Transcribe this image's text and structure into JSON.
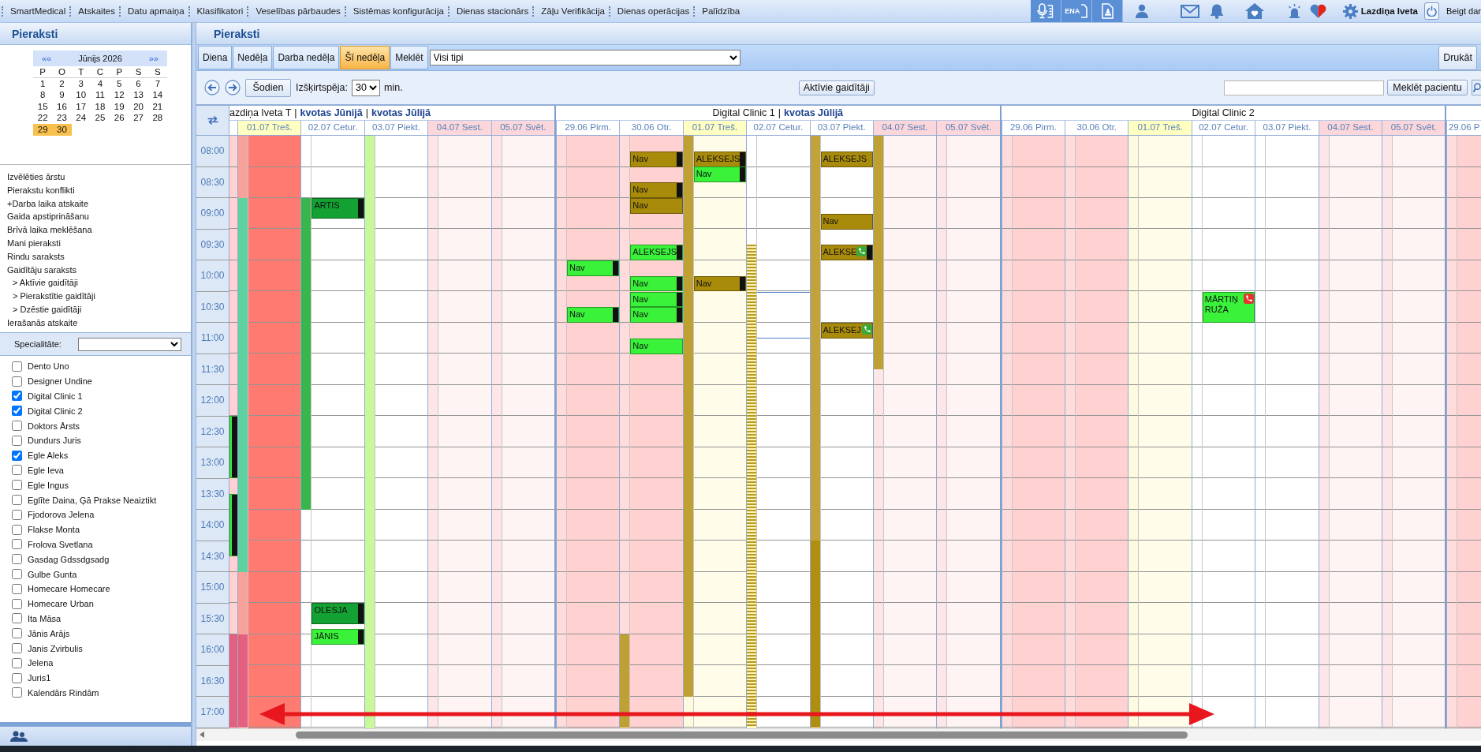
{
  "menu_bar": {
    "items": [
      "SmartMedical",
      "Atskaites",
      "Datu apmaiņa",
      "Klasifikatori",
      "Veselības pārbaudes",
      "Sistēmas konfigurācija",
      "Dienas stacionārs",
      "Zāļu Verifikācija",
      "Dienas operācijas",
      "Palīdzība"
    ],
    "quick_buttons": [
      {
        "kind": "dictation"
      },
      {
        "kind": "ena",
        "label": "ENA"
      },
      {
        "kind": "stamp"
      }
    ],
    "user": "Lazdiņa Iveta",
    "logout": "Beigt dar"
  },
  "left_panel": {
    "title": "Pieraksti",
    "calendar": {
      "prev": "««",
      "month": "Jūnijs 2026",
      "next": "»»",
      "weekdays": [
        "P",
        "O",
        "T",
        "C",
        "P",
        "S",
        "S"
      ],
      "weeks": [
        [
          {
            "day": "1",
            "selected": false
          },
          {
            "day": "2",
            "selected": false
          },
          {
            "day": "3",
            "selected": false
          },
          {
            "day": "4",
            "selected": false
          },
          {
            "day": "5",
            "selected": false
          },
          {
            "day": "6",
            "selected": false
          },
          {
            "day": "7",
            "selected": false
          }
        ],
        [
          {
            "day": "8",
            "selected": false
          },
          {
            "day": "9",
            "selected": false
          },
          {
            "day": "10",
            "selected": false
          },
          {
            "day": "11",
            "selected": false
          },
          {
            "day": "12",
            "selected": false
          },
          {
            "day": "13",
            "selected": false
          },
          {
            "day": "14",
            "selected": false
          }
        ],
        [
          {
            "day": "15",
            "selected": false
          },
          {
            "day": "16",
            "selected": false
          },
          {
            "day": "17",
            "selected": false
          },
          {
            "day": "18",
            "selected": false
          },
          {
            "day": "19",
            "selected": false
          },
          {
            "day": "20",
            "selected": false
          },
          {
            "day": "21",
            "selected": false
          }
        ],
        [
          {
            "day": "22",
            "selected": false
          },
          {
            "day": "23",
            "selected": false
          },
          {
            "day": "24",
            "selected": false
          },
          {
            "day": "25",
            "selected": false
          },
          {
            "day": "26",
            "selected": false
          },
          {
            "day": "27",
            "selected": false
          },
          {
            "day": "28",
            "selected": false
          }
        ],
        [
          {
            "day": "29",
            "selected": true
          },
          {
            "day": "30",
            "selected": true
          }
        ]
      ]
    },
    "links": [
      {
        "label": "Izvēlēties ārstu"
      },
      {
        "label": "Pierakstu konflikti"
      },
      {
        "label": "+Darba laika atskaite"
      },
      {
        "label": "Gaida apstiprināšanu"
      },
      {
        "label": "Brīvā laika meklēšana"
      },
      {
        "label": "Mani pieraksti"
      },
      {
        "label": "Rindu saraksts"
      },
      {
        "label": "Gaidītāju saraksts",
        "children": [
          {
            "label": "> Aktīvie gaidītāji"
          },
          {
            "label": "> Pierakstītie gaidītāji"
          },
          {
            "label": "> Dzēstie gaidītāji"
          }
        ]
      },
      {
        "label": "Ierašanās atskaite"
      }
    ],
    "specialty": {
      "label": "Specialitāte:"
    },
    "doctors": [
      {
        "name": "Dento Uno",
        "checked": false
      },
      {
        "name": "Designer Undine",
        "checked": false
      },
      {
        "name": "Digital Clinic 1",
        "checked": true
      },
      {
        "name": "Digital Clinic 2",
        "checked": true
      },
      {
        "name": "Doktors Ārsts",
        "checked": false
      },
      {
        "name": "Dundurs Juris",
        "checked": false
      },
      {
        "name": "Egle Aleks",
        "checked": true
      },
      {
        "name": "Egle Ieva",
        "checked": false
      },
      {
        "name": "Egle Ingus",
        "checked": false
      },
      {
        "name": "Eglīte Daina, Ģā Prakse Neaiztikt",
        "checked": false
      },
      {
        "name": "Fjodorova Jelena",
        "checked": false
      },
      {
        "name": "Flakse Monta",
        "checked": false
      },
      {
        "name": "Frolova Svetlana",
        "checked": false
      },
      {
        "name": "Gasdag Gdssdgsadg",
        "checked": false
      },
      {
        "name": "Gulbe Gunta",
        "checked": false
      },
      {
        "name": "Homecare Homecare",
        "checked": false
      },
      {
        "name": "Homecare Urban",
        "checked": false
      },
      {
        "name": "Ita Māsa",
        "checked": false
      },
      {
        "name": "Jānis Arājs",
        "checked": false
      },
      {
        "name": "Janis Zvirbulis",
        "checked": false
      },
      {
        "name": "Jelena",
        "checked": false
      },
      {
        "name": "Juris1",
        "checked": false
      },
      {
        "name": "Kalendārs Rindām",
        "checked": false
      }
    ]
  },
  "main": {
    "title": "Pieraksti",
    "tabs": [
      {
        "label": "Diena",
        "selected": false
      },
      {
        "label": "Nedēļa",
        "selected": false
      },
      {
        "label": "Darba nedēļa",
        "selected": false
      },
      {
        "label": "Šī nedēļa",
        "selected": true
      },
      {
        "label": "Meklēt",
        "selected": false
      }
    ],
    "type_filter": "Visi tipi",
    "print": "Drukāt",
    "toolbar": {
      "today": "Šodien",
      "resolution_label": "Izšķirtspēja:",
      "resolution": "30",
      "unit": "min.",
      "waitlist": "Aktīvie gaidītāji",
      "search_button": "Meklēt pacientu"
    },
    "schedule": {
      "times": [
        "08:00",
        "08:30",
        "09:00",
        "09:30",
        "10:00",
        "10:30",
        "11:00",
        "11:30",
        "12:00",
        "12:30",
        "13:00",
        "13:30",
        "14:00",
        "14:30",
        "15:00",
        "15:30",
        "16:00",
        "16:30",
        "17:00"
      ],
      "groups": [
        {
          "title": "azdiņa Iveta T",
          "links": [
            {
              "separator": "|",
              "label": "kvotas Jūnijā"
            },
            {
              "separator": "|",
              "label": "kvotas Jūlijā"
            }
          ],
          "days": [
            {
              "kind": "past",
              "absent": false,
              "items": [
                {
                  "kind": "appointment",
                  "color": "#39f239",
                  "marker": true
                },
                {
                  "kind": "appointment",
                  "color": "#39f239",
                  "marker": true
                },
                {
                  "kind": "fill",
                  "color": "#e4607e"
                }
              ]
            },
            {
              "label": "01.07 Treš.",
              "kind": "today",
              "absent": true,
              "stripe": [
                {
                  "kind": "solid",
                  "color": "#f6a19c"
                },
                {
                  "kind": "solid",
                  "color": "#5fd0a0"
                },
                {
                  "kind": "solid",
                  "color": "#f6a19c"
                },
                {
                  "kind": "solid",
                  "color": "#e4607e"
                }
              ]
            },
            {
              "label": "02.07 Cetur.",
              "kind": "workday",
              "absent": false,
              "stripe": [
                {
                  "kind": "solid",
                  "color": "#38b54b"
                }
              ],
              "items": [
                {
                  "kind": "appointment",
                  "text": "ARTIS",
                  "color": "#13a133",
                  "marker": true
                },
                {
                  "kind": "appointment",
                  "text": "OLESJA",
                  "color": "#13a133",
                  "marker": true
                },
                {
                  "kind": "appointment",
                  "text": "JĀNIS",
                  "color": "#39f239",
                  "marker": true
                }
              ]
            },
            {
              "label": "03.07 Piekt.",
              "kind": "workday",
              "absent": false,
              "stripe": [
                {
                  "kind": "solid",
                  "color": "#c9f79b"
                }
              ]
            },
            {
              "label": "04.07 Sest.",
              "kind": "weekend",
              "absent": false
            },
            {
              "label": "05.07 Svēt.",
              "kind": "weekend",
              "absent": false
            }
          ]
        },
        {
          "title": "Digital Clinic 1",
          "links": [
            {
              "separator": "|",
              "label": "kvotas Jūlijā"
            }
          ],
          "days": [
            {
              "label": "29.06 Pirm.",
              "kind": "past",
              "absent": false,
              "items": [
                {
                  "kind": "appointment",
                  "text": "Nav",
                  "color": "#39f239",
                  "marker": true
                },
                {
                  "kind": "appointment",
                  "text": "Nav",
                  "color": "#39f239",
                  "marker": true
                }
              ]
            },
            {
              "label": "30.06 Otr.",
              "kind": "past",
              "absent": false,
              "stripe": [
                {
                  "kind": "solid",
                  "color": "#bfa032"
                }
              ],
              "items": [
                {
                  "kind": "appointment",
                  "text": "Nav",
                  "color": "#a98b0b",
                  "marker": true
                },
                {
                  "kind": "appointment",
                  "text": "Nav",
                  "color": "#a98b0b",
                  "marker": true
                },
                {
                  "kind": "appointment",
                  "text": "Nav",
                  "color": "#a98b0b",
                  "marker": false
                },
                {
                  "kind": "appointment",
                  "text": "ALEKSEJS",
                  "color": "#39f239",
                  "marker": true
                },
                {
                  "kind": "appointment",
                  "text": "Nav",
                  "color": "#39f239",
                  "marker": true
                },
                {
                  "kind": "appointment",
                  "text": "Nav",
                  "color": "#39f239",
                  "marker": true
                },
                {
                  "kind": "appointment",
                  "text": "Nav",
                  "color": "#39f239",
                  "marker": true
                },
                {
                  "kind": "appointment",
                  "text": "Nav",
                  "color": "#39f239",
                  "marker": false
                }
              ]
            },
            {
              "label": "01.07 Treš.",
              "kind": "today",
              "absent": false,
              "stripe": [
                {
                  "kind": "solid",
                  "color": "#bfa032"
                }
              ],
              "items": [
                {
                  "kind": "appointment",
                  "text": "ALEKSEJS",
                  "color": "#a98b0b",
                  "marker": true
                },
                {
                  "kind": "appointment",
                  "text": "Nav",
                  "color": "#39f239",
                  "marker": true
                },
                {
                  "kind": "appointment",
                  "text": "Nav",
                  "color": "#a98b0b",
                  "marker": true
                }
              ]
            },
            {
              "label": "02.07 Cetur.",
              "kind": "workday",
              "absent": false,
              "stripe": [
                {
                  "kind": "hatched",
                  "color": "#b89a1e"
                }
              ],
              "items": [
                {
                  "kind": "outline"
                }
              ]
            },
            {
              "label": "03.07 Piekt.",
              "kind": "workday",
              "absent": false,
              "stripe": [
                {
                  "kind": "solid",
                  "color": "#c2a23a"
                },
                {
                  "kind": "solid",
                  "color": "#b08f10"
                }
              ],
              "items": [
                {
                  "kind": "appointment",
                  "text": "ALEKSEJS",
                  "color": "#a98b0b",
                  "marker": false
                },
                {
                  "kind": "appointment",
                  "text": "Nav",
                  "color": "#a98b0b",
                  "marker": false
                },
                {
                  "kind": "appointment",
                  "text": "ALEKSE",
                  "color": "#a98b0b",
                  "marker": true,
                  "phone": {
                    "color": "#3aa935"
                  }
                },
                {
                  "kind": "appointment",
                  "text": "ALEKSEJ",
                  "color": "#a98b0b",
                  "marker": false,
                  "phone": {
                    "color": "#3aa935"
                  }
                }
              ]
            },
            {
              "label": "04.07 Sest.",
              "kind": "weekend",
              "absent": false,
              "stripe": [
                {
                  "kind": "solid",
                  "color": "#bfa032"
                }
              ]
            },
            {
              "label": "05.07 Svēt.",
              "kind": "weekend",
              "absent": false
            }
          ]
        },
        {
          "title": "Digital Clinic 2",
          "days": [
            {
              "label": "29.06 Pirm.",
              "kind": "past",
              "absent": false
            },
            {
              "label": "30.06 Otr.",
              "kind": "past",
              "absent": false
            },
            {
              "label": "01.07 Treš.",
              "kind": "today",
              "absent": false
            },
            {
              "label": "02.07 Cetur.",
              "kind": "workday",
              "absent": false,
              "items": [
                {
                  "kind": "appointment",
                  "text": "MĀRTIŅ RUŽA",
                  "color": "#39f239",
                  "marker": false,
                  "phone": {
                    "color": "#e5322d"
                  }
                }
              ]
            },
            {
              "label": "03.07 Piekt.",
              "kind": "workday",
              "absent": false
            },
            {
              "label": "04.07 Sest.",
              "kind": "weekend",
              "absent": false
            },
            {
              "label": "05.07 Svēt.",
              "kind": "weekend",
              "absent": false
            }
          ]
        },
        {
          "days": [
            {
              "label": "29.06 P",
              "kind": "past",
              "absent": false
            }
          ]
        }
      ]
    }
  },
  "overlay": {
    "kind": "double_arrow"
  }
}
